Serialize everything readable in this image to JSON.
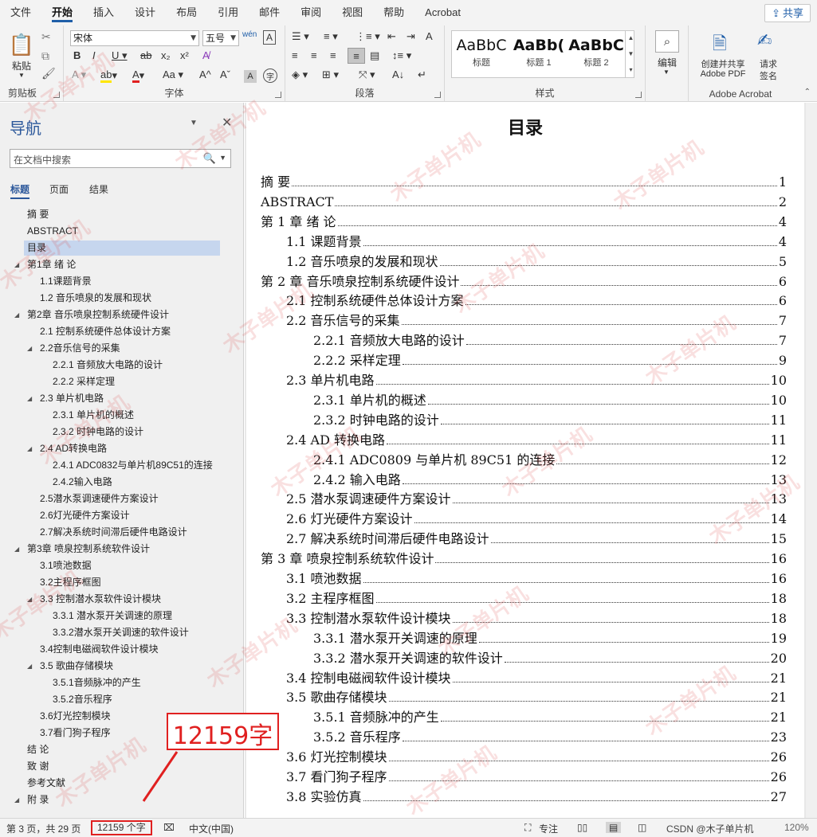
{
  "menubar": {
    "tabs": [
      "文件",
      "开始",
      "插入",
      "设计",
      "布局",
      "引用",
      "邮件",
      "审阅",
      "视图",
      "帮助",
      "Acrobat"
    ],
    "active_tab": "开始",
    "share_label": "共享"
  },
  "ribbon": {
    "clipboard": {
      "paste_label": "粘贴",
      "group_label": "剪贴板"
    },
    "font": {
      "font_name": "宋体",
      "font_size": "五号",
      "group_label": "字体"
    },
    "paragraph": {
      "group_label": "段落"
    },
    "styles": {
      "group_label": "样式",
      "items": [
        {
          "sample": "AaBbC",
          "name": "标题"
        },
        {
          "sample": "AaBb(",
          "name": "标题 1"
        },
        {
          "sample": "AaBbC",
          "name": "标题 2"
        }
      ]
    },
    "editing": {
      "label": "编辑"
    },
    "acrobat": {
      "create_label_1": "创建并共享",
      "create_label_2": "Adobe PDF",
      "sign_label_1": "请求",
      "sign_label_2": "签名",
      "group_label": "Adobe Acrobat"
    }
  },
  "nav": {
    "title": "导航",
    "search_placeholder": "在文档中搜索",
    "tabs": [
      "标题",
      "页面",
      "结果"
    ],
    "items": [
      {
        "label": "摘 要",
        "level": 1,
        "caret": false,
        "selected": false
      },
      {
        "label": "ABSTRACT",
        "level": 1,
        "caret": false,
        "selected": false
      },
      {
        "label": "目录",
        "level": 1,
        "caret": false,
        "selected": true
      },
      {
        "label": "第1章 绪 论",
        "level": 1,
        "caret": true,
        "selected": false
      },
      {
        "label": "1.1课题背景",
        "level": 2,
        "caret": false,
        "selected": false
      },
      {
        "label": "1.2 音乐喷泉的发展和现状",
        "level": 2,
        "caret": false,
        "selected": false
      },
      {
        "label": "第2章 音乐喷泉控制系统硬件设计",
        "level": 1,
        "caret": true,
        "selected": false
      },
      {
        "label": "2.1 控制系统硬件总体设计方案",
        "level": 2,
        "caret": false,
        "selected": false
      },
      {
        "label": "2.2音乐信号的采集",
        "level": 2,
        "caret": true,
        "selected": false
      },
      {
        "label": "2.2.1 音频放大电路的设计",
        "level": 3,
        "caret": false,
        "selected": false
      },
      {
        "label": "2.2.2 采样定理",
        "level": 3,
        "caret": false,
        "selected": false
      },
      {
        "label": "2.3 单片机电路",
        "level": 2,
        "caret": true,
        "selected": false
      },
      {
        "label": "2.3.1 单片机的概述",
        "level": 3,
        "caret": false,
        "selected": false
      },
      {
        "label": "2.3.2 时钟电路的设计",
        "level": 3,
        "caret": false,
        "selected": false
      },
      {
        "label": "2.4 AD转换电路",
        "level": 2,
        "caret": true,
        "selected": false
      },
      {
        "label": "2.4.1 ADC0832与单片机89C51的连接",
        "level": 3,
        "caret": false,
        "selected": false
      },
      {
        "label": "2.4.2输入电路",
        "level": 3,
        "caret": false,
        "selected": false
      },
      {
        "label": "2.5潜水泵调速硬件方案设计",
        "level": 2,
        "caret": false,
        "selected": false
      },
      {
        "label": "2.6灯光硬件方案设计",
        "level": 2,
        "caret": false,
        "selected": false
      },
      {
        "label": "2.7解决系统时间滞后硬件电路设计",
        "level": 2,
        "caret": false,
        "selected": false
      },
      {
        "label": "第3章 喷泉控制系统软件设计",
        "level": 1,
        "caret": true,
        "selected": false
      },
      {
        "label": "3.1喷池数据",
        "level": 2,
        "caret": false,
        "selected": false
      },
      {
        "label": "3.2主程序框图",
        "level": 2,
        "caret": false,
        "selected": false
      },
      {
        "label": "3.3 控制潜水泵软件设计模块",
        "level": 2,
        "caret": true,
        "selected": false
      },
      {
        "label": "3.3.1 潜水泵开关调速的原理",
        "level": 3,
        "caret": false,
        "selected": false
      },
      {
        "label": "3.3.2潜水泵开关调速的软件设计",
        "level": 3,
        "caret": false,
        "selected": false
      },
      {
        "label": "3.4控制电磁阀软件设计模块",
        "level": 2,
        "caret": false,
        "selected": false
      },
      {
        "label": "3.5 歌曲存储模块",
        "level": 2,
        "caret": true,
        "selected": false
      },
      {
        "label": "3.5.1音频脉冲的产生",
        "level": 3,
        "caret": false,
        "selected": false
      },
      {
        "label": "3.5.2音乐程序",
        "level": 3,
        "caret": false,
        "selected": false
      },
      {
        "label": "3.6灯光控制模块",
        "level": 2,
        "caret": false,
        "selected": false
      },
      {
        "label": "3.7看门狗子程序",
        "level": 2,
        "caret": false,
        "selected": false
      },
      {
        "label": "结 论",
        "level": 1,
        "caret": false,
        "selected": false
      },
      {
        "label": "致 谢",
        "level": 1,
        "caret": false,
        "selected": false
      },
      {
        "label": "参考文献",
        "level": 1,
        "caret": false,
        "selected": false
      },
      {
        "label": "附 录",
        "level": 1,
        "caret": true,
        "selected": false
      }
    ]
  },
  "document": {
    "toc_title": "目录",
    "toc": [
      {
        "text": "摘  要",
        "page": "1",
        "level": 0
      },
      {
        "text": "ABSTRACT",
        "page": "2",
        "level": 0
      },
      {
        "text": "第 1 章  绪  论",
        "page": "4",
        "level": 0
      },
      {
        "text": "1.1 课题背景",
        "page": "4",
        "level": 1
      },
      {
        "text": "1.2  音乐喷泉的发展和现状",
        "page": "5",
        "level": 1
      },
      {
        "text": "第 2 章  音乐喷泉控制系统硬件设计",
        "page": "6",
        "level": 0
      },
      {
        "text": "2.1  控制系统硬件总体设计方案",
        "page": "6",
        "level": 1
      },
      {
        "text": "2.2 音乐信号的采集",
        "page": "7",
        "level": 1
      },
      {
        "text": "2.2.1  音频放大电路的设计",
        "page": "7",
        "level": 2
      },
      {
        "text": "2.2.2  采样定理",
        "page": "9",
        "level": 2
      },
      {
        "text": "2.3  单片机电路",
        "page": "10",
        "level": 1
      },
      {
        "text": "2.3.1  单片机的概述",
        "page": "10",
        "level": 2
      },
      {
        "text": "2.3.2  时钟电路的设计",
        "page": "11",
        "level": 2
      },
      {
        "text": "2.4 AD 转换电路",
        "page": "11",
        "level": 1
      },
      {
        "text": "2.4.1 ADC0809 与单片机 89C51 的连接",
        "page": "12",
        "level": 2
      },
      {
        "text": "2.4.2 输入电路",
        "page": "13",
        "level": 2
      },
      {
        "text": "2.5 潜水泵调速硬件方案设计",
        "page": "13",
        "level": 1
      },
      {
        "text": "2.6 灯光硬件方案设计",
        "page": "14",
        "level": 1
      },
      {
        "text": "2.7 解决系统时间滞后硬件电路设计",
        "page": "15",
        "level": 1
      },
      {
        "text": "第 3 章    喷泉控制系统软件设计",
        "page": "16",
        "level": 0
      },
      {
        "text": "3.1 喷池数据",
        "page": "16",
        "level": 1
      },
      {
        "text": "3.2 主程序框图",
        "page": "18",
        "level": 1
      },
      {
        "text": "3.3  控制潜水泵软件设计模块",
        "page": "18",
        "level": 1
      },
      {
        "text": "3.3.1  潜水泵开关调速的原理",
        "page": "19",
        "level": 2
      },
      {
        "text": "3.3.2 潜水泵开关调速的软件设计",
        "page": "20",
        "level": 2
      },
      {
        "text": "3.4 控制电磁阀软件设计模块",
        "page": "21",
        "level": 1
      },
      {
        "text": "3.5  歌曲存储模块",
        "page": "21",
        "level": 1
      },
      {
        "text": "3.5.1 音频脉冲的产生",
        "page": "21",
        "level": 2
      },
      {
        "text": "3.5.2 音乐程序",
        "page": "23",
        "level": 2
      },
      {
        "text": "3.6 灯光控制模块",
        "page": "26",
        "level": 1
      },
      {
        "text": "3.7 看门狗子程序",
        "page": "26",
        "level": 1
      },
      {
        "text": "3.8 实验仿真",
        "page": "27",
        "level": 1
      }
    ]
  },
  "annotation": {
    "text": "12159字"
  },
  "statusbar": {
    "page_info": "第 3 页，共 29 页",
    "word_count": "12159 个字",
    "language": "中文(中国)",
    "focus": "专注",
    "zoom": "120%",
    "credit": "CSDN @木子单片机"
  },
  "watermark": {
    "text": "木子单片机"
  },
  "colors": {
    "accent": "#2b579a",
    "annotation": "#e02020"
  }
}
